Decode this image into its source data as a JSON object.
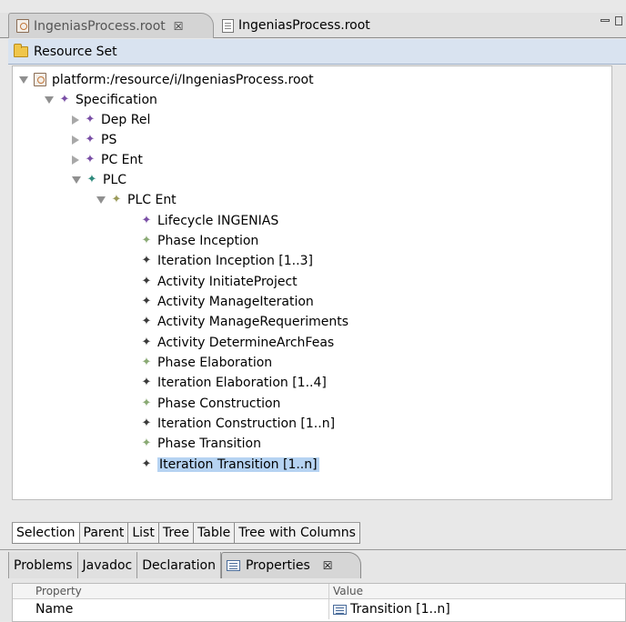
{
  "editor": {
    "tabs": [
      {
        "label": "IngeniasProcess.root",
        "close": "☒"
      },
      {
        "label": "IngeniasProcess.root"
      }
    ],
    "resource_set_label": "Resource Set"
  },
  "tree": {
    "root": "platform:/resource/i/IngeniasProcess.root",
    "specification": "Specification",
    "dep_rel": "Dep Rel",
    "ps": "PS",
    "pc_ent": "PC Ent",
    "plc": "PLC",
    "plc_ent": "PLC Ent",
    "items": [
      {
        "label": "Lifecycle INGENIAS",
        "icon": "purple-diamond"
      },
      {
        "label": "Phase Inception",
        "icon": "green-diamond"
      },
      {
        "label": "Iteration Inception [1..3]",
        "icon": "dark-diamond"
      },
      {
        "label": "Activity InitiateProject",
        "icon": "dark-diamond"
      },
      {
        "label": "Activity ManageIteration",
        "icon": "dark-diamond"
      },
      {
        "label": "Activity ManageRequeriments",
        "icon": "dark-diamond"
      },
      {
        "label": "Activity DetermineArchFeas",
        "icon": "dark-diamond"
      },
      {
        "label": "Phase Elaboration",
        "icon": "green-diamond"
      },
      {
        "label": "Iteration Elaboration [1..4]",
        "icon": "dark-diamond"
      },
      {
        "label": "Phase Construction",
        "icon": "green-diamond"
      },
      {
        "label": "Iteration Construction [1..n]",
        "icon": "dark-diamond"
      },
      {
        "label": "Phase Transition",
        "icon": "green-diamond"
      },
      {
        "label": "Iteration Transition [1..n]",
        "icon": "dark-diamond",
        "selected": true
      }
    ]
  },
  "view_tabs": [
    "Selection",
    "Parent",
    "List",
    "Tree",
    "Table",
    "Tree with Columns"
  ],
  "bottom": {
    "tabs": [
      "Problems",
      "Javadoc",
      "Declaration"
    ],
    "active_tab": "Properties",
    "active_close": "☒",
    "headers": {
      "property": "Property",
      "value": "Value"
    },
    "row": {
      "property": "Name",
      "value": "Transition [1..n]"
    }
  }
}
